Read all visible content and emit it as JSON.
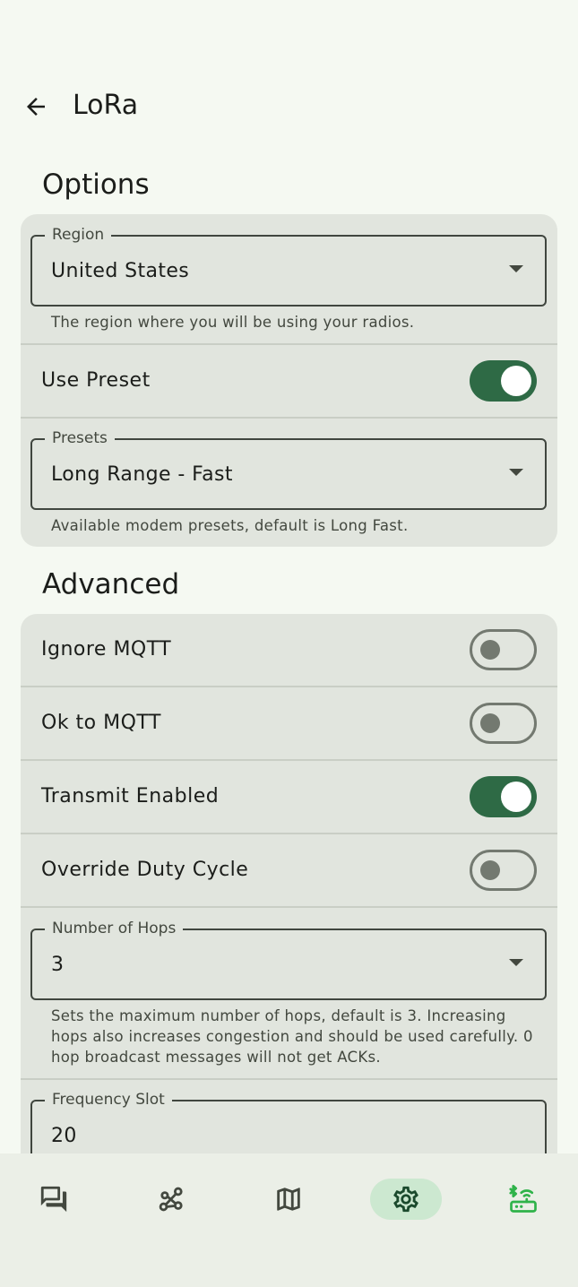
{
  "header": {
    "title": "LoRa"
  },
  "options": {
    "heading": "Options",
    "region": {
      "label": "Region",
      "value": "United States",
      "helper": "The region where you will be using your radios."
    },
    "use_preset": {
      "label": "Use Preset",
      "checked": true
    },
    "presets": {
      "label": "Presets",
      "value": "Long Range - Fast",
      "helper": "Available modem presets, default is Long Fast."
    }
  },
  "advanced": {
    "heading": "Advanced",
    "ignore_mqtt": {
      "label": "Ignore MQTT",
      "checked": false
    },
    "ok_to_mqtt": {
      "label": "Ok to MQTT",
      "checked": false
    },
    "transmit_enabled": {
      "label": "Transmit Enabled",
      "checked": true
    },
    "override_duty_cycle": {
      "label": "Override Duty Cycle",
      "checked": false
    },
    "number_of_hops": {
      "label": "Number of Hops",
      "value": "3",
      "helper": "Sets the maximum number of hops, default is 3. Increasing hops also increases congestion and should be used carefully. 0 hop broadcast messages will not get ACKs."
    },
    "frequency_slot": {
      "label": "Frequency Slot",
      "value": "20"
    }
  },
  "bottom_nav": {
    "items": [
      {
        "icon": "messages-icon",
        "active": false
      },
      {
        "icon": "nodes-icon",
        "active": false
      },
      {
        "icon": "map-icon",
        "active": false
      },
      {
        "icon": "settings-icon",
        "active": true
      },
      {
        "icon": "bluetooth-router-icon",
        "active": false
      }
    ]
  },
  "colors": {
    "background": "#f5f9f2",
    "card": "#e1e5de",
    "primary": "#2e6a45",
    "nav_active_pill": "#cce8d0",
    "connected_icon": "#2fb34a"
  }
}
